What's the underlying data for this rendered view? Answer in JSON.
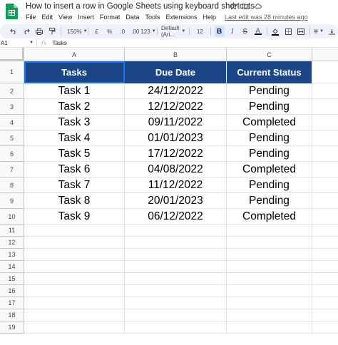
{
  "app": {
    "document_title": "How to insert a row in Google Sheets using keyboard shortcuts",
    "last_edit": "Last edit was 28 minutes ago"
  },
  "menu": [
    {
      "label": "File"
    },
    {
      "label": "Edit"
    },
    {
      "label": "View"
    },
    {
      "label": "Insert"
    },
    {
      "label": "Format"
    },
    {
      "label": "Data"
    },
    {
      "label": "Tools"
    },
    {
      "label": "Extensions"
    },
    {
      "label": "Help"
    }
  ],
  "toolbar": {
    "zoom": "150%",
    "currency": "£",
    "percent": "%",
    "decrease_decimal": ".0",
    "increase_decimal": ".00",
    "more_formats": "123",
    "font": "Default (Ari...",
    "font_size": "12",
    "bold": "B",
    "italic": "I",
    "strikethrough": "S",
    "text_color": "A"
  },
  "formula_bar": {
    "name_box": "A1",
    "fx": "fx",
    "content": "Tasks"
  },
  "grid": {
    "columns": [
      "A",
      "B",
      "C"
    ],
    "row_numbers": [
      "1",
      "2",
      "3",
      "4",
      "5",
      "6",
      "7",
      "8",
      "9",
      "10",
      "11",
      "12",
      "13",
      "14",
      "15",
      "16",
      "17",
      "18",
      "19"
    ],
    "header": [
      "Tasks",
      "Due Date",
      "Current Status"
    ],
    "rows": [
      [
        "Task 1",
        "24/12/2022",
        "Pending"
      ],
      [
        "Task 2",
        "12/12/2022",
        "Pending"
      ],
      [
        "Task 3",
        "09/11/2022",
        "Completed"
      ],
      [
        "Task 4",
        "01/01/2023",
        "Pending"
      ],
      [
        "Task 5",
        "17/12/2022",
        "Pending"
      ],
      [
        "Task 6",
        "04/08/2022",
        "Completed"
      ],
      [
        "Task 7",
        "11/12/2022",
        "Pending"
      ],
      [
        "Task 8",
        "20/01/2023",
        "Pending"
      ],
      [
        "Task 9",
        "06/12/2022",
        "Completed"
      ]
    ]
  },
  "colors": {
    "header_fill": "#1c4587",
    "header_text": "#ffffff",
    "sheets_green": "#0f9d58"
  }
}
